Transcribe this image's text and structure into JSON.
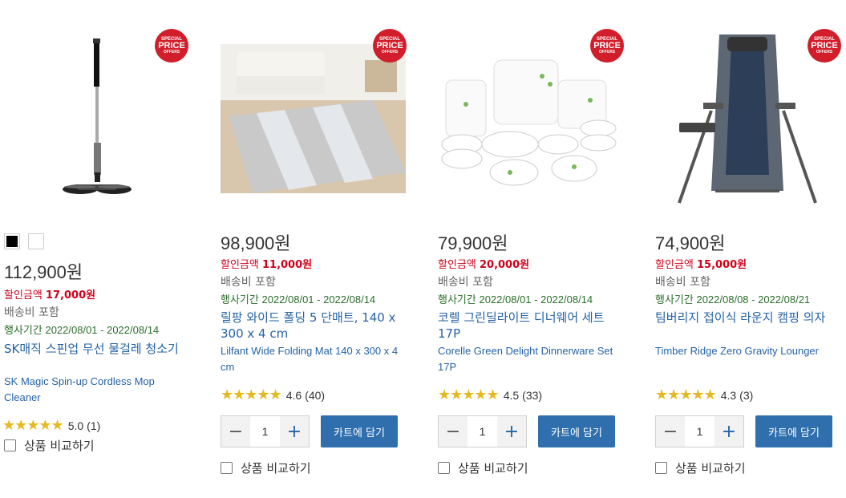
{
  "products": [
    {
      "badge": {
        "line1": "SPECIAL",
        "line2": "PRICE",
        "line3": "OFFERS"
      },
      "image_icon": "cordless-mop-image",
      "swatches": [
        {
          "color": "#000000"
        },
        {
          "color": "#ffffff"
        }
      ],
      "price": "112,900원",
      "discount_label": "할인금액",
      "discount_amount": "17,000원",
      "shipping": "배송비 포함",
      "period_label": "행사기간",
      "period": "2022/08/01 - 2022/08/14",
      "title_ko": "SK매직 스핀업 무선 물걸레 청소기",
      "title_en": "SK Magic Spin-up Cordless Mop Cleaner",
      "stars": "★★★★★",
      "rating": "5.0",
      "reviews": "(1)",
      "compare": "상품 비교하기"
    },
    {
      "badge": {
        "line1": "SPECIAL",
        "line2": "PRICE",
        "line3": "OFFERS"
      },
      "image_icon": "folding-mat-image",
      "price": "98,900원",
      "discount_label": "할인금액",
      "discount_amount": "11,000원",
      "shipping": "배송비 포함",
      "period_label": "행사기간",
      "period": "2022/08/01 - 2022/08/14",
      "title_ko": "릴팡 와이드 폴딩 5 단매트, 140 x 300 x 4 cm",
      "title_en": "Lilfant Wide Folding Mat 140 x 300 x 4 cm",
      "stars": "★★★★★",
      "rating": "4.6",
      "reviews": "(40)",
      "qty": "1",
      "cart": "카트에 담기",
      "compare": "상품 비교하기"
    },
    {
      "badge": {
        "line1": "SPECIAL",
        "line2": "PRICE",
        "line3": "OFFERS"
      },
      "image_icon": "dinnerware-set-image",
      "price": "79,900원",
      "discount_label": "할인금액",
      "discount_amount": "20,000원",
      "shipping": "배송비 포함",
      "period_label": "행사기간",
      "period": "2022/08/01 - 2022/08/14",
      "title_ko": "코렐 그린딜라이트 디너웨어 세트 17P",
      "title_en": "Corelle Green Delight Dinnerware Set 17P",
      "stars": "★★★★★",
      "rating": "4.5",
      "reviews": "(33)",
      "qty": "1",
      "cart": "카트에 담기",
      "compare": "상품 비교하기"
    },
    {
      "badge": {
        "line1": "SPECIAL",
        "line2": "PRICE",
        "line3": "OFFERS"
      },
      "image_icon": "lounger-chair-image",
      "price": "74,900원",
      "discount_label": "할인금액",
      "discount_amount": "15,000원",
      "shipping": "배송비 포함",
      "period_label": "행사기간",
      "period": "2022/08/08 - 2022/08/21",
      "title_ko": "팀버리지 접이식 라운지 캠핑 의자",
      "title_en": "Timber Ridge Zero Gravity Lounger",
      "stars": "★★★★★",
      "rating": "4.3",
      "reviews": "(3)",
      "qty": "1",
      "cart": "카트에 담기",
      "compare": "상품 비교하기"
    }
  ],
  "colors": {
    "discount": "#d0021b",
    "link": "#2563a6",
    "cart_button": "#2f6fad",
    "badge": "#d21e2b",
    "star": "#e5b922"
  }
}
